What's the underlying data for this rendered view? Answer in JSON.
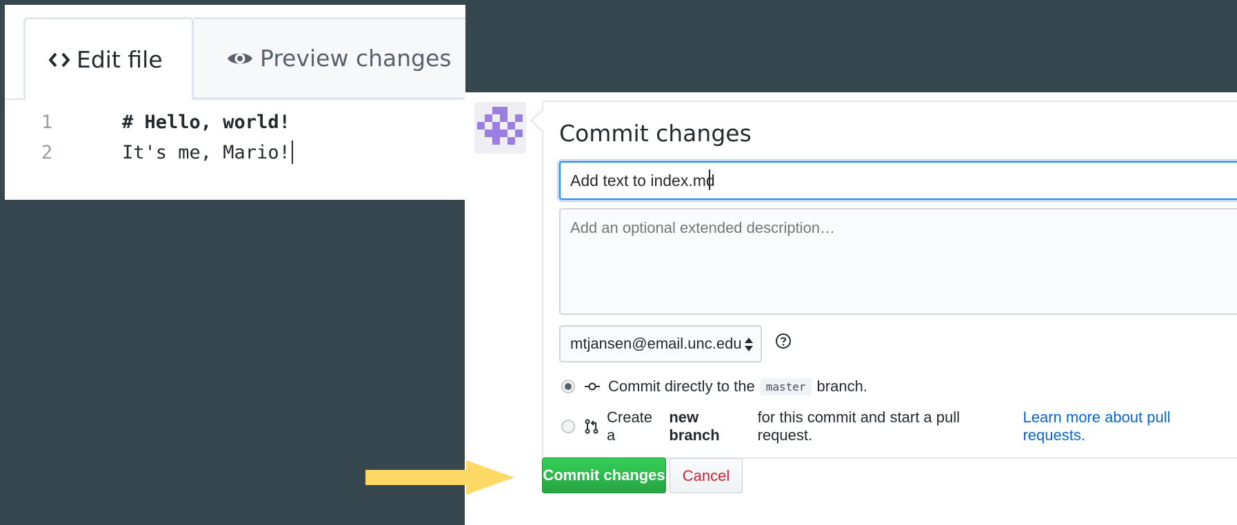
{
  "editor": {
    "tabs": [
      {
        "label": "Edit file",
        "icon": "code-icon",
        "active": true
      },
      {
        "label": "Preview changes",
        "icon": "eye-icon",
        "active": false
      }
    ],
    "lines": [
      {
        "number": "1",
        "text": "# Hello, world!"
      },
      {
        "number": "2",
        "text": "It's me, Mario!"
      }
    ]
  },
  "commit": {
    "title": "Commit changes",
    "summary_value": "Add text to index.md",
    "description_placeholder": "Add an optional extended description…",
    "email_value": "mtjansen@email.unc.edu",
    "option_direct": {
      "prefix": "Commit directly to the",
      "branch": "master",
      "suffix": "branch.",
      "selected": true
    },
    "option_new_branch": {
      "prefix": "Create a",
      "bold": "new branch",
      "suffix": "for this commit and start a pull request.",
      "link": "Learn more about pull requests.",
      "selected": false
    },
    "commit_button": "Commit changes",
    "cancel_button": "Cancel"
  },
  "colors": {
    "background": "#37474f",
    "commit_green": "#28a745",
    "cancel_red": "#cb2431",
    "link_blue": "#0366d6",
    "arrow_yellow": "#ffd966",
    "avatar_purple": "#9b7fe0"
  }
}
